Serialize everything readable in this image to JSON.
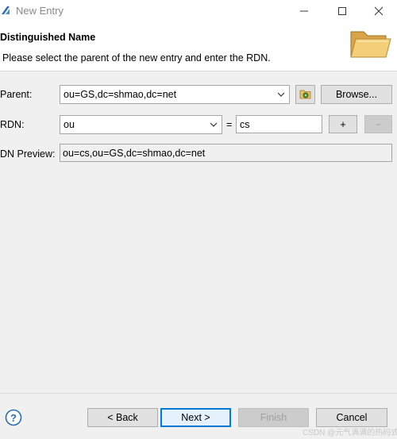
{
  "window": {
    "title": "New Entry",
    "controls": {
      "minimize": "minimize",
      "maximize": "maximize",
      "close": "close"
    }
  },
  "header": {
    "title": "Distinguished Name",
    "description": "Please select the parent of the new entry and enter the RDN.",
    "icon": "folder-icon"
  },
  "form": {
    "parent_label": "Parent:",
    "parent_value": "ou=GS,dc=shmao,dc=net",
    "browse_label": "Browse...",
    "rdn_label": "RDN:",
    "rdn_attribute": "ou",
    "equals": "=",
    "rdn_value": "cs",
    "add_label": "+",
    "remove_label": "−",
    "preview_label": "DN Preview:",
    "preview_value": "ou=cs,ou=GS,dc=shmao,dc=net"
  },
  "footer": {
    "back_label": "< Back",
    "next_label": "Next >",
    "finish_label": "Finish",
    "cancel_label": "Cancel"
  },
  "watermark": "CSDN @元气满满的热码式"
}
